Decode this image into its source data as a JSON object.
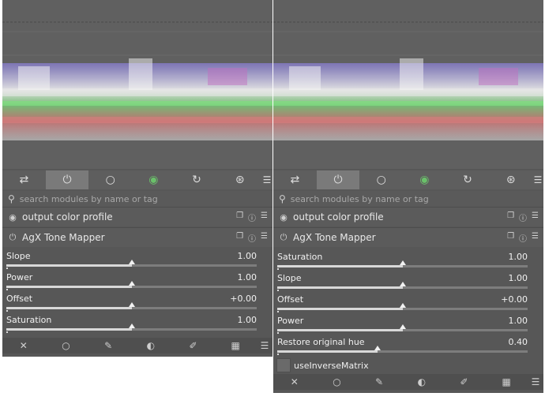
{
  "left": {
    "search_placeholder": "search modules by name or tag",
    "tabs": [
      {
        "icon": "sliders-icon",
        "glyph": "⇄"
      },
      {
        "icon": "power-icon",
        "glyph": "⏻"
      },
      {
        "icon": "circle-icon",
        "glyph": "○"
      },
      {
        "icon": "color-wheel-icon",
        "glyph": "◉"
      },
      {
        "icon": "refresh-icon",
        "glyph": "↻"
      },
      {
        "icon": "aperture-icon",
        "glyph": "⊛"
      },
      {
        "icon": "menu-icon",
        "glyph": "☰"
      }
    ],
    "modules": {
      "output_color_profile": "output color profile",
      "agx_tone_mapper": "AgX Tone Mapper"
    },
    "params": [
      {
        "label": "Slope",
        "value": "1.00",
        "fraction": 0.5
      },
      {
        "label": "Power",
        "value": "1.00",
        "fraction": 0.5
      },
      {
        "label": "Offset",
        "value": "+0.00",
        "fraction": 0.5
      },
      {
        "label": "Saturation",
        "value": "1.00",
        "fraction": 0.5
      }
    ]
  },
  "right": {
    "search_placeholder": "search modules by name or tag",
    "modules": {
      "output_color_profile": "output color profile",
      "agx_tone_mapper": "AgX Tone Mapper"
    },
    "params": [
      {
        "label": "Saturation",
        "value": "1.00",
        "fraction": 0.5
      },
      {
        "label": "Slope",
        "value": "1.00",
        "fraction": 0.5
      },
      {
        "label": "Offset",
        "value": "+0.00",
        "fraction": 0.5
      },
      {
        "label": "Power",
        "value": "1.00",
        "fraction": 0.5
      },
      {
        "label": "Restore original hue",
        "value": "0.40",
        "fraction": 0.4
      }
    ],
    "checkbox_label": "useInverseMatrix"
  },
  "icons": {
    "module_enabled": "power-icon",
    "module_preset": "presets-icon",
    "module_reset": "reset-icon",
    "module_menu": "menu-icon",
    "bottom": [
      "close-icon",
      "circle-icon",
      "pencil-icon",
      "moon-icon",
      "brush-icon",
      "checker-icon",
      "menu-icon"
    ]
  }
}
